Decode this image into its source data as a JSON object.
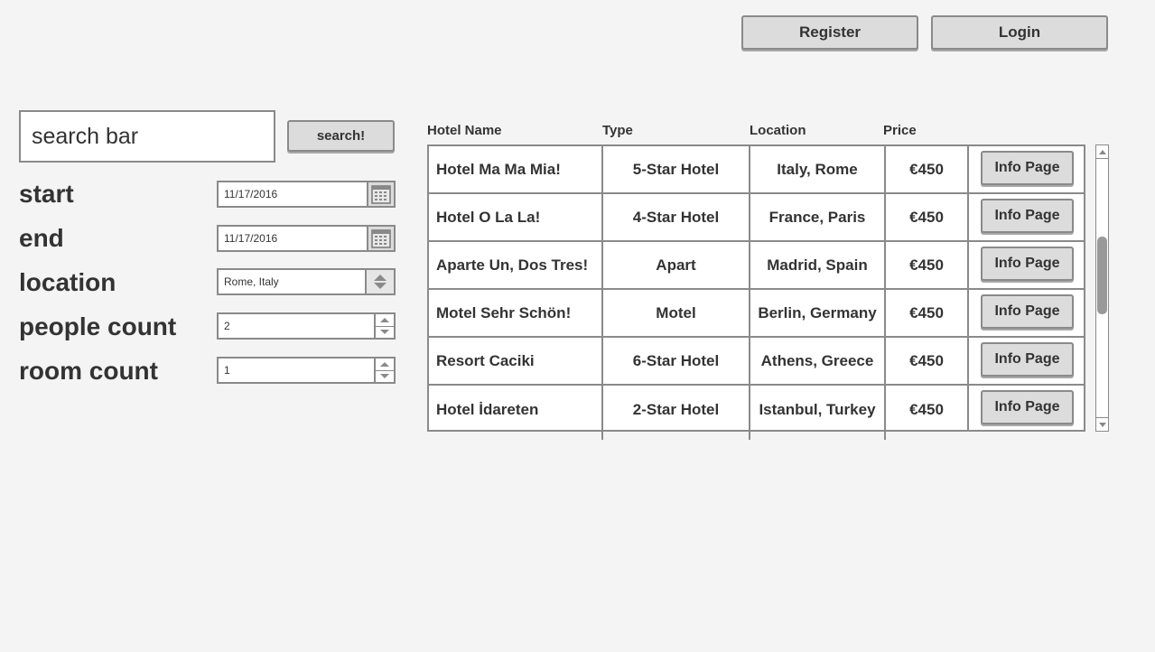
{
  "header": {
    "register_label": "Register",
    "login_label": "Login"
  },
  "search": {
    "placeholder": "search bar",
    "button_label": "search!"
  },
  "form": {
    "start": {
      "label": "start",
      "value": "11/17/2016"
    },
    "end": {
      "label": "end",
      "value": "11/17/2016"
    },
    "location": {
      "label": "location",
      "value": "Rome, Italy"
    },
    "people": {
      "label": "people count",
      "value": "2"
    },
    "rooms": {
      "label": "room count",
      "value": "1"
    }
  },
  "table": {
    "headers": {
      "name": "Hotel Name",
      "type": "Type",
      "location": "Location",
      "price": "Price"
    },
    "rows": [
      {
        "name": "Hotel Ma Ma Mia!",
        "type": "5-Star Hotel",
        "location": "Italy, Rome",
        "price": "€450",
        "action": "Info Page"
      },
      {
        "name": "Hotel O La La!",
        "type": "4-Star Hotel",
        "location": "France, Paris",
        "price": "€450",
        "action": "Info Page"
      },
      {
        "name": "Aparte Un, Dos Tres!",
        "type": "Apart",
        "location": "Madrid, Spain",
        "price": "€450",
        "action": "Info Page"
      },
      {
        "name": "Motel Sehr Schön!",
        "type": "Motel",
        "location": "Berlin, Germany",
        "price": "€450",
        "action": "Info Page"
      },
      {
        "name": "Resort Caciki",
        "type": "6-Star Hotel",
        "location": "Athens, Greece",
        "price": "€450",
        "action": "Info Page"
      },
      {
        "name": "Hotel İdareten",
        "type": "2-Star Hotel",
        "location": "Istanbul, Turkey",
        "price": "€450",
        "action": "Info Page"
      }
    ]
  },
  "icons": {
    "calendar": "calendar-icon",
    "dropdown": "up-down-arrows-icon",
    "stepper": "stepper-arrows-icon"
  },
  "colors": {
    "background": "#f4f4f4",
    "border": "#8a8a8a",
    "button": "#dcdcdc",
    "text": "#333333"
  }
}
